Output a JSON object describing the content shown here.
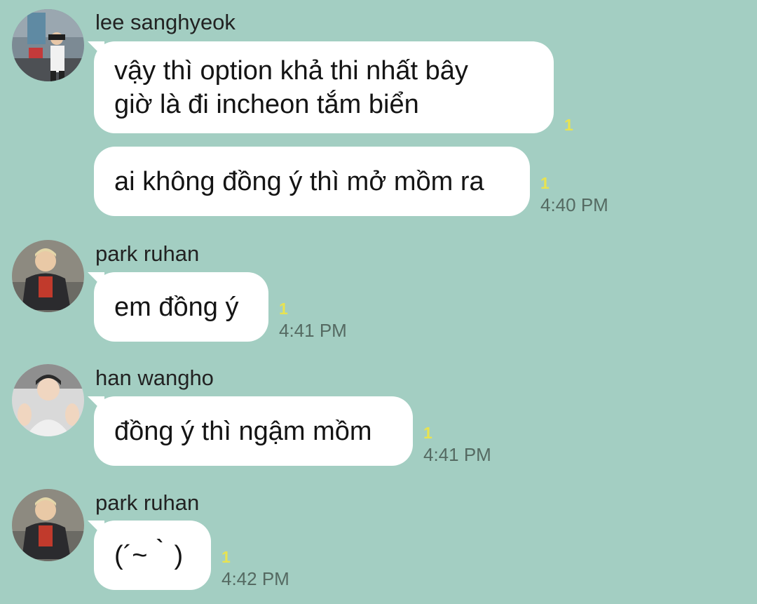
{
  "messages": [
    {
      "sender": "lee sanghyeok",
      "bubbles": [
        {
          "text": "vậy thì option khả thi nhất bây\ngiờ là đi incheon tắm biển",
          "unread": "1",
          "time": ""
        },
        {
          "text": "ai không đồng ý thì mở mồm ra",
          "unread": "1",
          "time": "4:40 PM"
        }
      ]
    },
    {
      "sender": "park ruhan",
      "bubbles": [
        {
          "text": "em đồng ý",
          "unread": "1",
          "time": "4:41 PM"
        }
      ]
    },
    {
      "sender": "han wangho",
      "bubbles": [
        {
          "text": "đồng ý thì ngậm mồm",
          "unread": "1",
          "time": "4:41 PM"
        }
      ]
    },
    {
      "sender": "park ruhan",
      "bubbles": [
        {
          "text": "(´~｀)",
          "unread": "1",
          "time": "4:42 PM"
        }
      ]
    }
  ],
  "colors": {
    "background": "#a3cec2",
    "bubble": "#ffffff",
    "unread": "#e8e350",
    "time": "#556a62"
  }
}
